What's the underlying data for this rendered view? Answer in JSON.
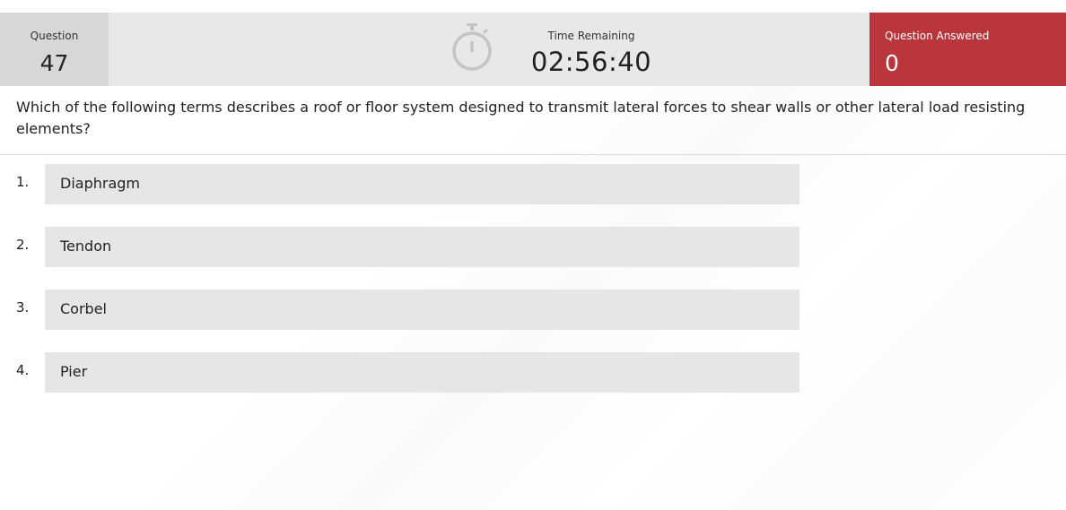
{
  "header": {
    "question_label": "Question",
    "question_number": "47",
    "time_label": "Time Remaining",
    "time_value": "02:56:40",
    "answered_label": "Question Answered",
    "answered_value": "0",
    "timer_icon": "stopwatch-icon",
    "colors": {
      "header_bg": "#e8e8e8",
      "question_box_bg": "#d7d7d7",
      "answered_bg": "#b9373c"
    }
  },
  "question": {
    "text": "Which of the following terms describes a roof or floor system designed to transmit lateral forces to shear walls or other lateral load resisting elements?"
  },
  "choices": [
    {
      "number": "1.",
      "label": "Diaphragm"
    },
    {
      "number": "2.",
      "label": "Tendon"
    },
    {
      "number": "3.",
      "label": "Corbel"
    },
    {
      "number": "4.",
      "label": "Pier"
    }
  ]
}
